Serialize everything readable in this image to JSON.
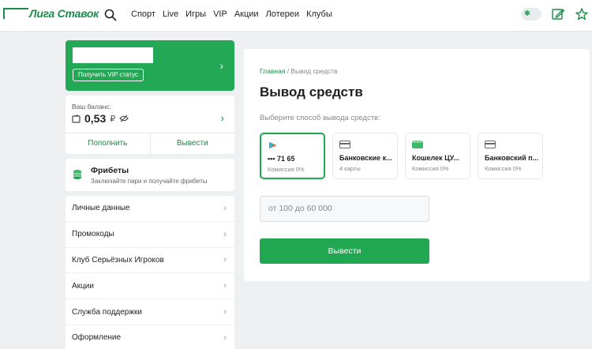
{
  "header": {
    "logo": "Лига Ставок",
    "nav": [
      "Спорт",
      "Live",
      "Игры",
      "VIP",
      "Акции",
      "Лотереи",
      "Клубы"
    ]
  },
  "sidebar": {
    "vip_button": "Получить VIP статус",
    "balance_label": "Ваш баланс:",
    "balance_amount": "0,53",
    "balance_currency": "₽",
    "deposit": "Пополнить",
    "withdraw": "Вывести",
    "freebets_title": "Фрибеты",
    "freebets_sub": "Заключайте пари и получайте фрибеты",
    "menu": [
      {
        "label": "Личные данные"
      },
      {
        "label": "Промокоды"
      },
      {
        "label": "Клуб Серьёзных Игроков"
      },
      {
        "label": "Акции"
      },
      {
        "label": "Служба поддержки"
      },
      {
        "label": "Оформление"
      }
    ]
  },
  "main": {
    "breadcrumb_home": "Главная",
    "breadcrumb_sep": "/",
    "breadcrumb_current": "Вывод средств",
    "title": "Вывод средств",
    "hint": "Выберите способ вывода средств:",
    "methods": [
      {
        "name": "••• 71 65",
        "sub": "Комиссия 0%",
        "icon": "payment-play-icon"
      },
      {
        "name": "Банковские к...",
        "sub": "4 карты",
        "icon": "bank-card-icon"
      },
      {
        "name": "Кошелек ЦУ...",
        "sub": "Комиссия 0%",
        "icon": "wallet-icon"
      },
      {
        "name": "Банковский п...",
        "sub": "Комиссия 0%",
        "icon": "bank-card-icon"
      }
    ],
    "amount_placeholder": "от 100 до 60 000",
    "submit": "Вывести"
  },
  "colors": {
    "brand": "#23a855",
    "accent_text": "#1a8c4a"
  }
}
